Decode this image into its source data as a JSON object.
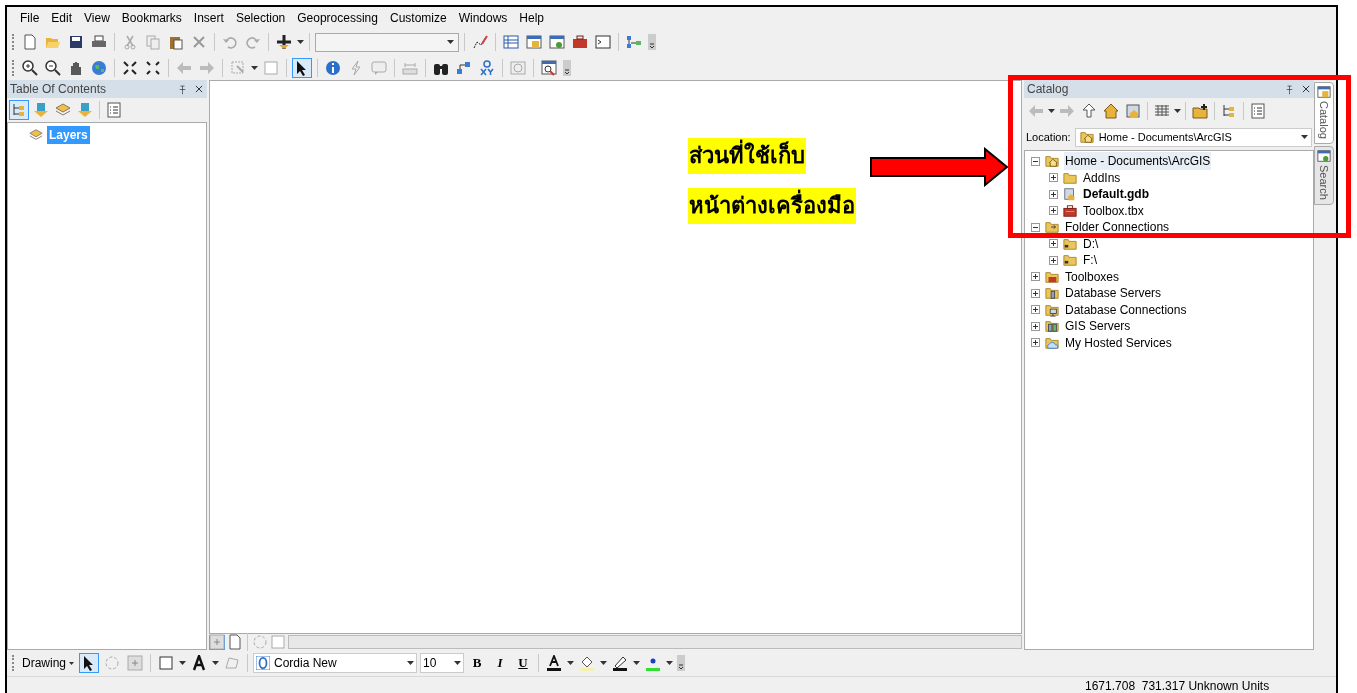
{
  "menu_bar": [
    "File",
    "Edit",
    "View",
    "Bookmarks",
    "Insert",
    "Selection",
    "Geoprocessing",
    "Customize",
    "Windows",
    "Help"
  ],
  "table_of_contents": {
    "title": "Table Of Contents",
    "layers": [
      {
        "label": "Layers",
        "selected": true
      }
    ]
  },
  "catalog": {
    "title": "Catalog",
    "location_label": "Location:",
    "location": "Home - Documents\\ArcGIS",
    "tree": [
      {
        "label": "Home - Documents\\ArcGIS",
        "kind": "home-folder",
        "expanded": true,
        "selected": true,
        "bold": false,
        "children": [
          {
            "label": "AddIns",
            "kind": "folder",
            "expanded": false,
            "selected": false,
            "bold": false
          },
          {
            "label": "Default.gdb",
            "kind": "geodatabase",
            "expanded": false,
            "selected": false,
            "bold": true
          },
          {
            "label": "Toolbox.tbx",
            "kind": "toolbox",
            "expanded": false,
            "selected": false,
            "bold": false
          }
        ]
      },
      {
        "label": "Folder Connections",
        "kind": "connection-folder",
        "expanded": true,
        "selected": false,
        "bold": false,
        "children": [
          {
            "label": "D:\\",
            "kind": "drive-folder",
            "expanded": false,
            "selected": false,
            "bold": false
          },
          {
            "label": "F:\\",
            "kind": "drive-folder",
            "expanded": false,
            "selected": false,
            "bold": false
          }
        ]
      },
      {
        "label": "Toolboxes",
        "kind": "toolboxes",
        "expanded": false,
        "selected": false,
        "bold": false
      },
      {
        "label": "Database Servers",
        "kind": "database-servers",
        "expanded": false,
        "selected": false,
        "bold": false
      },
      {
        "label": "Database Connections",
        "kind": "database-connections",
        "expanded": false,
        "selected": false,
        "bold": false
      },
      {
        "label": "GIS Servers",
        "kind": "gis-servers",
        "expanded": false,
        "selected": false,
        "bold": false
      },
      {
        "label": "My Hosted Services",
        "kind": "hosted-services",
        "expanded": false,
        "selected": false,
        "bold": false
      }
    ]
  },
  "side_tabs": [
    {
      "label": "Catalog",
      "selected": true
    },
    {
      "label": "Search",
      "selected": false
    }
  ],
  "drawing_toolbar": {
    "label": "Drawing",
    "font": "Cordia New",
    "font_size": "10",
    "styles": [
      "B",
      "I",
      "U"
    ]
  },
  "status_bar": {
    "coordinates": "1671.708  731.317 Unknown Units"
  },
  "annotation": {
    "lines": [
      "ส่วนที่ใช้เก็บ",
      "หน้าต่างเครื่องมือ"
    ]
  }
}
